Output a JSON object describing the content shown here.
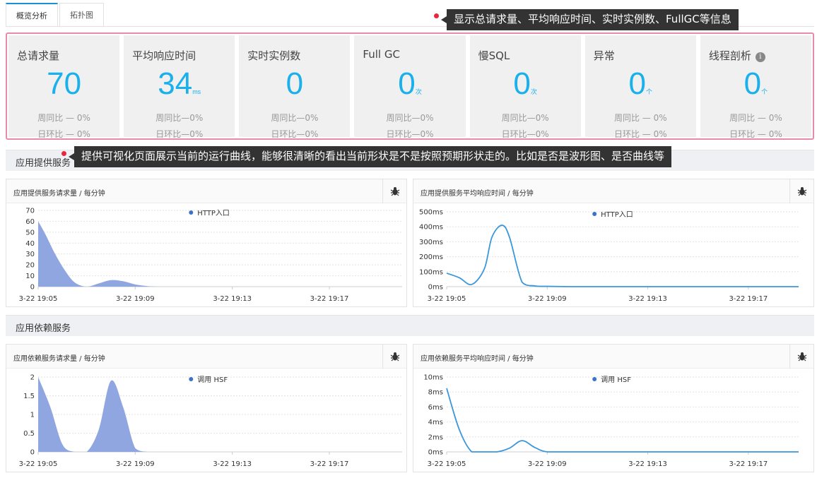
{
  "tabs": [
    {
      "label": "概览分析",
      "active": true
    },
    {
      "label": "拓扑图",
      "active": false
    }
  ],
  "callouts": {
    "metrics_note": "显示总请求量、平均响应时间、实时实例数、FullGC等信息",
    "charts_note": "提供可视化页面展示当前的运行曲线，能够很清晰的看出当前形状是不是按照预期形状走的。比如是否是波形图、是否曲线等"
  },
  "metrics": [
    {
      "label": "总请求量",
      "value": "70",
      "unit": "",
      "week": "周同比 — 0%",
      "day": "日环比 — 0%"
    },
    {
      "label": "平均响应时间",
      "value": "34",
      "unit": "ms",
      "week": "周同比—0%",
      "day": "日环比—0%"
    },
    {
      "label": "实时实例数",
      "value": "0",
      "unit": "",
      "week": "周同比—0%",
      "day": "日环比—0%"
    },
    {
      "label": "Full GC",
      "value": "0",
      "unit": "次",
      "week": "周同比—0%",
      "day": "日环比—0%"
    },
    {
      "label": "慢SQL",
      "value": "0",
      "unit": "次",
      "week": "周同比—0%",
      "day": "日环比—0%"
    },
    {
      "label": "异常",
      "value": "0",
      "unit": "个",
      "week": "周同比 — 0%",
      "day": "日环比 — 0%"
    },
    {
      "label": "线程剖析",
      "value": "0",
      "unit": "个",
      "week": "周同比 — 0%",
      "day": "日环比 — 0%",
      "info_icon": true
    }
  ],
  "sections": {
    "provided": "应用提供服务",
    "dependent": "应用依赖服务"
  },
  "colors": {
    "accent": "#1ab0ec",
    "area_fill": "#8fa6e0",
    "line": "#3a97da",
    "legend_dot": "#3b73c7",
    "highlight_border": "#ea8aa9"
  },
  "chart_data": [
    {
      "panel_title": "应用提供服务请求量 / 每分钟",
      "type": "area",
      "x_ticks": [
        "3-22 19:05",
        "3-22 19:09",
        "3-22 19:13",
        "3-22 19:17"
      ],
      "y_ticks": [
        "0",
        "10",
        "20",
        "30",
        "40",
        "50",
        "60",
        "70"
      ],
      "ylim": [
        0,
        70
      ],
      "xlim": [
        0,
        15
      ],
      "x": [
        0,
        0.3,
        0.7,
        1.1,
        1.5,
        2,
        2.5,
        3,
        3.5,
        4,
        4.5,
        5,
        6,
        8,
        10,
        12,
        14,
        15
      ],
      "series": [
        {
          "name": "HTTP入口",
          "values": [
            60,
            48,
            30,
            15,
            4,
            0,
            3,
            6,
            5,
            2,
            0.5,
            0,
            0,
            0,
            0,
            0,
            0,
            0
          ]
        }
      ]
    },
    {
      "panel_title": "应用提供服务平均响应时间 / 每分钟",
      "type": "line",
      "x_ticks": [
        "3-22 19:05",
        "3-22 19:09",
        "3-22 19:13",
        "3-22 19:17"
      ],
      "y_ticks": [
        "0ms",
        "100ms",
        "200ms",
        "300ms",
        "400ms",
        "500ms"
      ],
      "ylim": [
        0,
        500
      ],
      "xlim": [
        0,
        14
      ],
      "x": [
        0,
        0.5,
        1,
        1.5,
        1.8,
        2.2,
        2.5,
        3,
        3.5,
        4,
        5,
        6,
        8,
        10,
        12,
        14
      ],
      "series": [
        {
          "name": "HTTP入口",
          "values": [
            90,
            60,
            15,
            120,
            330,
            410,
            330,
            30,
            5,
            2,
            0,
            0,
            0,
            0,
            0,
            0
          ]
        }
      ]
    },
    {
      "panel_title": "应用依赖服务请求量 / 每分钟",
      "type": "area",
      "x_ticks": [
        "3-22 19:05",
        "3-22 19:09",
        "3-22 19:13",
        "3-22 19:17"
      ],
      "y_ticks": [
        "0",
        "0.5",
        "1",
        "1.5",
        "2"
      ],
      "ylim": [
        0,
        2
      ],
      "xlim": [
        0,
        15
      ],
      "x": [
        0,
        0.5,
        1,
        1.5,
        2,
        2.5,
        3,
        3.5,
        4,
        4.5,
        5,
        6,
        8,
        10,
        12,
        14,
        15
      ],
      "series": [
        {
          "name": "调用 HSF",
          "values": [
            2,
            1.2,
            0.2,
            0,
            0,
            0.6,
            1.9,
            1.2,
            0.1,
            0,
            0,
            0,
            0,
            0,
            0,
            0,
            0
          ]
        }
      ]
    },
    {
      "panel_title": "应用依赖服务平均响应时间 / 每分钟",
      "type": "line",
      "x_ticks": [
        "3-22 19:05",
        "3-22 19:09",
        "3-22 19:13",
        "3-22 19:17"
      ],
      "y_ticks": [
        "0ms",
        "2ms",
        "4ms",
        "6ms",
        "8ms",
        "10ms"
      ],
      "ylim": [
        0,
        10
      ],
      "xlim": [
        0,
        14
      ],
      "x": [
        0,
        0.5,
        1,
        1.5,
        2,
        2.5,
        3,
        3.5,
        4,
        5,
        6,
        8,
        10,
        12,
        14
      ],
      "series": [
        {
          "name": "调用 HSF",
          "values": [
            8.5,
            3,
            0,
            0,
            0,
            0.5,
            1.5,
            0.6,
            0,
            0,
            0,
            0,
            0,
            0,
            0
          ]
        }
      ]
    }
  ]
}
